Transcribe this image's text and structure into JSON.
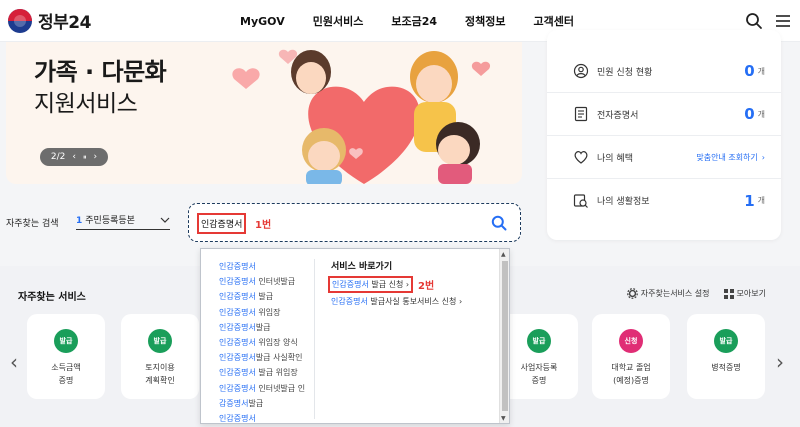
{
  "header": {
    "logo_text": "정부24",
    "nav": [
      "MyGOV",
      "민원서비스",
      "보조금24",
      "정책정보",
      "고객센터"
    ],
    "icons": [
      "search-icon",
      "menu-icon"
    ]
  },
  "banner": {
    "title_line1": "가족 · 다문화",
    "title_line2": "지원서비스",
    "pager_text": "2/2",
    "pager_prev": "‹",
    "pager_pause": "⏸",
    "pager_next": "›"
  },
  "panel": {
    "rows": [
      {
        "icon": "user-circle-icon",
        "label": "민원 신청 현황",
        "count": "0",
        "unit": "개"
      },
      {
        "icon": "document-icon",
        "label": "전자증명서",
        "count": "0",
        "unit": "개"
      },
      {
        "icon": "heart-icon",
        "label": "나의 혜택",
        "link": "맞춤안내 조회하기",
        "link_arrow": "›"
      },
      {
        "icon": "search-doc-icon",
        "label": "나의 생활정보",
        "count": "1",
        "unit": "개"
      }
    ]
  },
  "search": {
    "fav_label": "자주찾는 검색",
    "fav_num": "1",
    "fav_value": "주민등록등본",
    "query": "인감증명서",
    "annotation": "1번"
  },
  "autocomplete": {
    "suggestions": [
      {
        "hl": "인감증명서",
        "rest": ""
      },
      {
        "hl": "인감증명서",
        "rest": " 인터넷발급"
      },
      {
        "hl": "인감증명서",
        "rest": " 발급"
      },
      {
        "hl": "인감증명서",
        "rest": " 위임장"
      },
      {
        "hl": "인감증명서",
        "rest": "발급"
      },
      {
        "hl": "인감증명서",
        "rest": " 위임장 양식"
      },
      {
        "hl": "인감증명서",
        "rest": "발급 사실확인"
      },
      {
        "hl": "인감증명서",
        "rest": " 발급 위임장"
      },
      {
        "hl": "인감증명서",
        "rest": " 인터넷발급 인"
      },
      {
        "hl": "감증명서",
        "rest": "발급"
      },
      {
        "hl": "인감증명서",
        "rest": ""
      }
    ],
    "shortcut_title": "서비스 바로가기",
    "shortcut1_hl": "인감증명서",
    "shortcut1_rest": " 발급 신청  ›",
    "annotation": "2번",
    "shortcut2_hl": "인감증명서",
    "shortcut2_rest": " 발급사실 통보서비스 신청  ›"
  },
  "services": {
    "title": "자주찾는 서비스",
    "settings_label": "자주찾는서비스 설정",
    "viewall_label": "모아보기",
    "cards": [
      {
        "badge": "발급",
        "color": "#1a9e5a",
        "label": "소득금액\n증명"
      },
      {
        "badge": "발급",
        "color": "#1a9e5a",
        "label": "토지이용\n계획확인"
      },
      {
        "badge": "발급",
        "color": "#1a9e5a",
        "label": "사업자등록\n증명"
      },
      {
        "badge": "신청",
        "color": "#e02d75",
        "label": "대학교 졸업\n(예정)증명"
      },
      {
        "badge": "발급",
        "color": "#1a9e5a",
        "label": "병적증명"
      }
    ],
    "prev": "‹",
    "next": "›"
  }
}
